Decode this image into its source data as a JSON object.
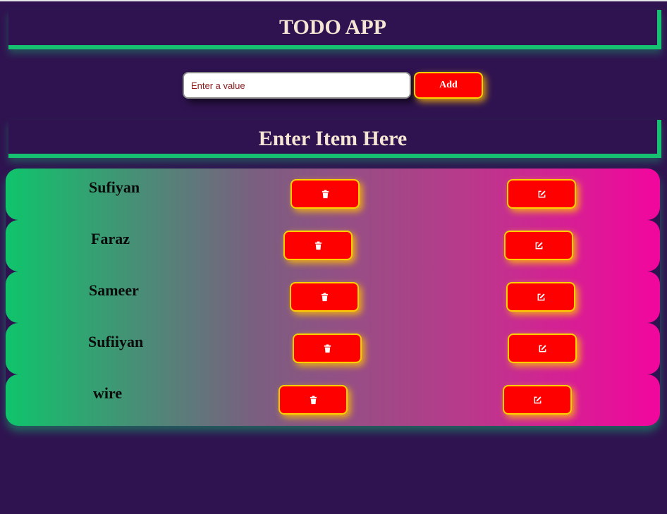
{
  "header": {
    "title": "TODO APP"
  },
  "form": {
    "placeholder": "Enter a value",
    "value": "",
    "add_label": "Add"
  },
  "subheader": {
    "title": "Enter Item Here"
  },
  "items": [
    {
      "name": "Sufiyan"
    },
    {
      "name": "Faraz"
    },
    {
      "name": "Sameer"
    },
    {
      "name": "Sufiiyan"
    },
    {
      "name": "wire"
    }
  ],
  "icons": {
    "delete": "trash-icon",
    "edit": "edit-icon"
  },
  "colors": {
    "background": "#2f1350",
    "accent": "#16c172",
    "button": "#ff0000",
    "button_border": "#ffd000",
    "gradient_start": "#0fc46b",
    "gradient_end": "#f2069d"
  }
}
